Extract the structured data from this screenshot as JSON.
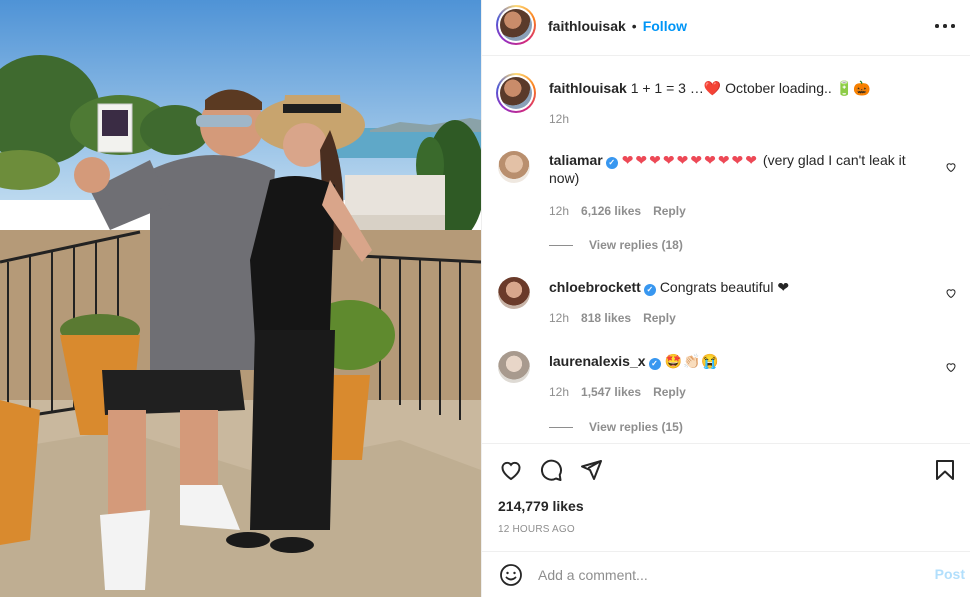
{
  "post": {
    "author": "faithlouisak",
    "follow_label": "Follow",
    "dot": "•",
    "image_alt": "Couple on a sunny terrace holding an ultrasound photo"
  },
  "caption": {
    "username": "faithlouisak",
    "text": "1 + 1 = 3 …❤️ October loading.. 🔋🎃",
    "time": "12h"
  },
  "comments": [
    {
      "username": "taliamar",
      "verified": true,
      "hearts": "❤❤❤❤❤❤❤❤❤❤",
      "text": "(very glad I can't leak it now)",
      "time": "12h",
      "likes": "6,126 likes",
      "reply_label": "Reply",
      "view_replies": "View replies (18)"
    },
    {
      "username": "chloebrockett",
      "verified": true,
      "text": "Congrats beautiful ❤",
      "time": "12h",
      "likes": "818 likes",
      "reply_label": "Reply"
    },
    {
      "username": "laurenalexis_x",
      "verified": true,
      "text": "🤩👏🏻😭",
      "time": "12h",
      "likes": "1,547 likes",
      "reply_label": "Reply",
      "view_replies": "View replies (15)"
    }
  ],
  "stats": {
    "likes": "214,779 likes",
    "time_ago": "12 HOURS AGO"
  },
  "add_comment": {
    "placeholder": "Add a comment...",
    "post_label": "Post"
  },
  "colors": {
    "accent": "#0095f6",
    "verified": "#3897f0",
    "heart": "#ed4956",
    "muted": "#8e8e8e",
    "post_disabled": "#b2dffc"
  },
  "icons": {
    "like": "heart-icon",
    "comment": "comment-bubble-icon",
    "share": "paper-plane-icon",
    "save": "bookmark-icon",
    "emoji": "smiley-icon",
    "more": "more-dots-icon"
  }
}
